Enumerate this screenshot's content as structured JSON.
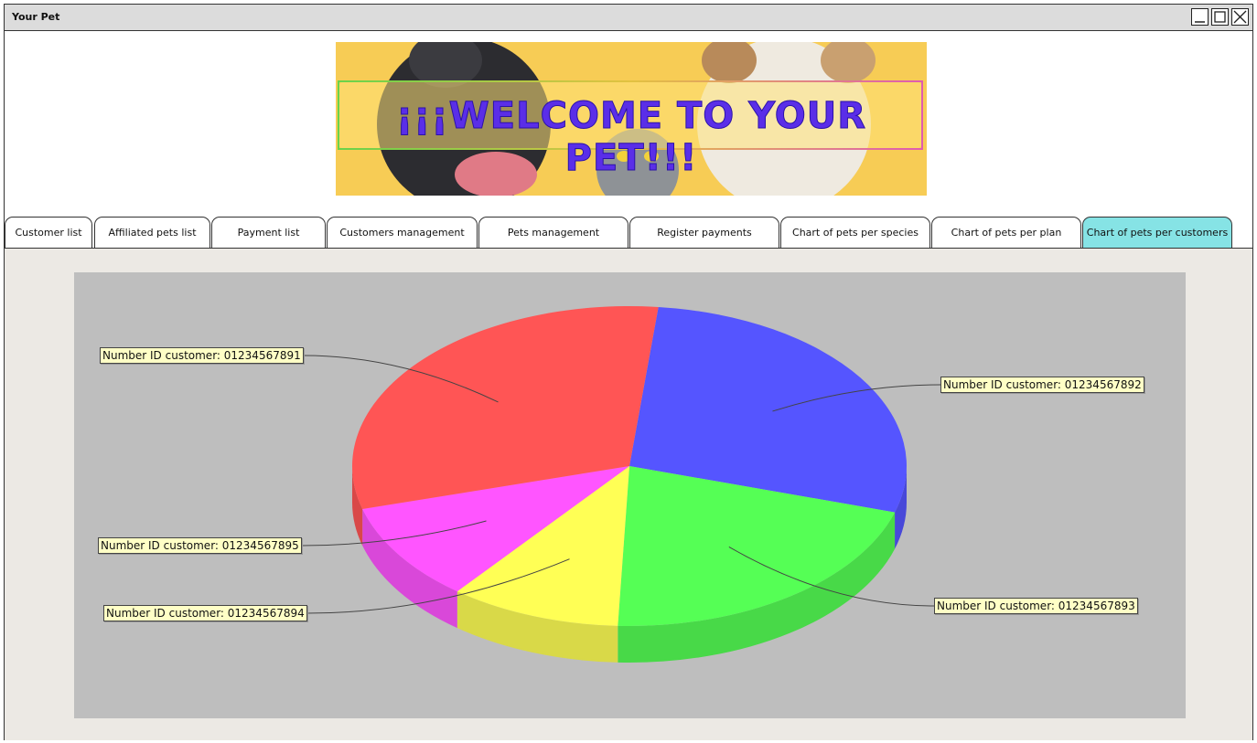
{
  "window": {
    "title": "Your Pet"
  },
  "banner": {
    "text": "¡¡¡WELCOME TO YOUR PET!!!"
  },
  "tabs": [
    {
      "label": "Customer list"
    },
    {
      "label": "Affiliated pets list"
    },
    {
      "label": "Payment list"
    },
    {
      "label": "Customers management"
    },
    {
      "label": "Pets management"
    },
    {
      "label": "Register payments"
    },
    {
      "label": "Chart of pets per species"
    },
    {
      "label": "Chart of pets per plan"
    },
    {
      "label": "Chart of pets per customers",
      "active": true
    }
  ],
  "chart_data": {
    "type": "pie",
    "slices": [
      {
        "label": "Number ID customer: 01234567891",
        "value": 31,
        "color": "#ff5555"
      },
      {
        "label": "Number ID customer: 01234567892",
        "value": 28,
        "color": "#5555ff"
      },
      {
        "label": "Number ID customer: 01234567893",
        "value": 21,
        "color": "#55ff55"
      },
      {
        "label": "Number ID customer: 01234567894",
        "value": 10,
        "color": "#ffff55"
      },
      {
        "label": "Number ID customer: 01234567895",
        "value": 10,
        "color": "#ff55ff"
      }
    ]
  },
  "colors": {
    "active_tab": "#86e3e5",
    "chart_background": "#bebebe",
    "panel_background": "#ece9e4",
    "label_background": "#ffffc6"
  }
}
